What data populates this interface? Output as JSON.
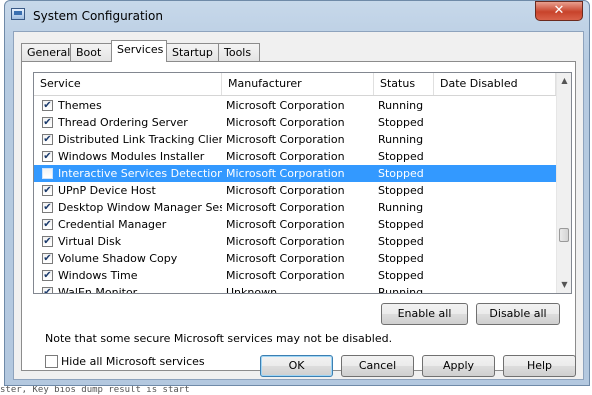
{
  "window": {
    "title": "System Configuration",
    "close_label": "✕"
  },
  "tabs": [
    {
      "label": "General"
    },
    {
      "label": "Boot"
    },
    {
      "label": "Services"
    },
    {
      "label": "Startup"
    },
    {
      "label": "Tools"
    }
  ],
  "active_tab": "Services",
  "columns": {
    "service": "Service",
    "manufacturer": "Manufacturer",
    "status": "Status",
    "date_disabled": "Date Disabled"
  },
  "services": [
    {
      "name": "Themes",
      "manufacturer": "Microsoft Corporation",
      "status": "Running",
      "checked": true
    },
    {
      "name": "Thread Ordering Server",
      "manufacturer": "Microsoft Corporation",
      "status": "Stopped",
      "checked": true
    },
    {
      "name": "Distributed Link Tracking Client",
      "manufacturer": "Microsoft Corporation",
      "status": "Running",
      "checked": true
    },
    {
      "name": "Windows Modules Installer",
      "manufacturer": "Microsoft Corporation",
      "status": "Stopped",
      "checked": true
    },
    {
      "name": "Interactive Services Detection",
      "manufacturer": "Microsoft Corporation",
      "status": "Stopped",
      "checked": false,
      "selected": true
    },
    {
      "name": "UPnP Device Host",
      "manufacturer": "Microsoft Corporation",
      "status": "Stopped",
      "checked": true
    },
    {
      "name": "Desktop Window Manager Sessi...",
      "manufacturer": "Microsoft Corporation",
      "status": "Running",
      "checked": true
    },
    {
      "name": "Credential Manager",
      "manufacturer": "Microsoft Corporation",
      "status": "Stopped",
      "checked": true
    },
    {
      "name": "Virtual Disk",
      "manufacturer": "Microsoft Corporation",
      "status": "Stopped",
      "checked": true
    },
    {
      "name": "Volume Shadow Copy",
      "manufacturer": "Microsoft Corporation",
      "status": "Stopped",
      "checked": true
    },
    {
      "name": "Windows Time",
      "manufacturer": "Microsoft Corporation",
      "status": "Stopped",
      "checked": true
    },
    {
      "name": "WalEn Monitor",
      "manufacturer": "Unknown",
      "status": "Running",
      "checked": true
    }
  ],
  "note": "Note that some secure Microsoft services may not be disabled.",
  "enable_all": "Enable all",
  "disable_all": "Disable all",
  "hide_ms_label": "Hide all Microsoft services",
  "buttons": {
    "ok": "OK",
    "cancel": "Cancel",
    "apply": "Apply",
    "help": "Help"
  },
  "background_text": "ster, Key bios dump result is start"
}
